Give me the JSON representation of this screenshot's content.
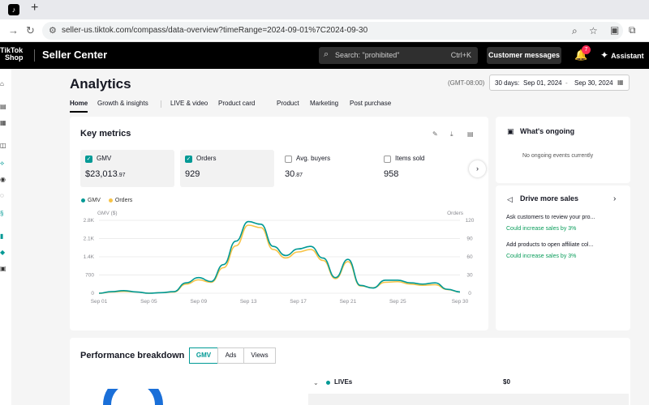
{
  "browser": {
    "tab_close": "×",
    "new_tab": "+",
    "url": "seller-us.tiktok.com/compass/data-overview?timeRange=2024-09-01%7C2024-09-30"
  },
  "header": {
    "logo_line1": "TikTok",
    "logo_line2": "Shop",
    "title": "Seller Center",
    "search_placeholder": "Search: \"prohibited\"",
    "search_shortcut": "Ctrl+K",
    "customer_messages": "Customer messages",
    "notif_count": "7",
    "assistant": "Assistant"
  },
  "page": {
    "title": "Analytics",
    "timezone": "(GMT-08:00)",
    "date_preset": "30 days:",
    "date_start": "Sep 01, 2024",
    "date_sep": "-",
    "date_end": "Sep 30, 2024"
  },
  "nav_tabs": [
    "Home",
    "Growth & insights",
    "LIVE & video",
    "Product card",
    "Product",
    "Marketing",
    "Post purchase"
  ],
  "key_metrics": {
    "title": "Key metrics",
    "metrics": [
      {
        "label": "GMV",
        "value": "$23,013",
        "decimal": ".97",
        "checked": true
      },
      {
        "label": "Orders",
        "value": "929",
        "decimal": "",
        "checked": true
      },
      {
        "label": "Avg. buyers",
        "value": "30",
        "decimal": ".87",
        "checked": false
      },
      {
        "label": "Items sold",
        "value": "958",
        "decimal": "",
        "checked": false
      }
    ],
    "legend_gmv": "GMV",
    "legend_orders": "Orders"
  },
  "colors": {
    "gmv": "#009995",
    "orders": "#f7c346",
    "accent": "#009995"
  },
  "chart_data": {
    "type": "line",
    "left_axis_label": "GMV ($)",
    "right_axis_label": "Orders",
    "left_ticks": [
      "0",
      "700",
      "1.4K",
      "2.1K",
      "2.8K"
    ],
    "right_ticks": [
      "0",
      "30",
      "60",
      "90",
      "120"
    ],
    "x_labels": [
      "Sep 01",
      "Sep 05",
      "Sep 09",
      "Sep 13",
      "Sep 17",
      "Sep 21",
      "Sep 25",
      "Sep 30"
    ],
    "x": [
      "Sep 01",
      "Sep 02",
      "Sep 03",
      "Sep 04",
      "Sep 05",
      "Sep 06",
      "Sep 07",
      "Sep 08",
      "Sep 09",
      "Sep 10",
      "Sep 11",
      "Sep 12",
      "Sep 13",
      "Sep 14",
      "Sep 15",
      "Sep 16",
      "Sep 17",
      "Sep 18",
      "Sep 19",
      "Sep 20",
      "Sep 21",
      "Sep 22",
      "Sep 23",
      "Sep 24",
      "Sep 25",
      "Sep 26",
      "Sep 27",
      "Sep 28",
      "Sep 29",
      "Sep 30"
    ],
    "ylim_left": [
      0,
      2800
    ],
    "ylim_right": [
      0,
      120
    ],
    "series": [
      {
        "name": "GMV",
        "axis": "left",
        "values": [
          0,
          60,
          100,
          50,
          0,
          20,
          60,
          400,
          600,
          450,
          1100,
          2000,
          2750,
          2650,
          1800,
          1450,
          1700,
          1800,
          1350,
          600,
          1300,
          300,
          200,
          500,
          500,
          400,
          350,
          400,
          150,
          50
        ]
      },
      {
        "name": "Orders",
        "axis": "right",
        "values": [
          0,
          2,
          3,
          2,
          0,
          1,
          2,
          15,
          22,
          18,
          42,
          78,
          112,
          108,
          72,
          58,
          68,
          72,
          54,
          24,
          52,
          12,
          9,
          18,
          19,
          15,
          13,
          14,
          6,
          2
        ]
      }
    ]
  },
  "whats_ongoing": {
    "title": "What's ongoing",
    "empty": "No ongoing events currently"
  },
  "drive_sales": {
    "title": "Drive more sales",
    "items": [
      {
        "title": "Ask customers to review your pro...",
        "sub": "Could increase sales by 3%"
      },
      {
        "title": "Add products to open affiliate col...",
        "sub": "Could increase sales by 3%"
      }
    ]
  },
  "performance": {
    "title": "Performance breakdown",
    "tabs": [
      "GMV",
      "Ads",
      "Views"
    ],
    "row_label": "LIVEs",
    "row_value": "$0"
  }
}
